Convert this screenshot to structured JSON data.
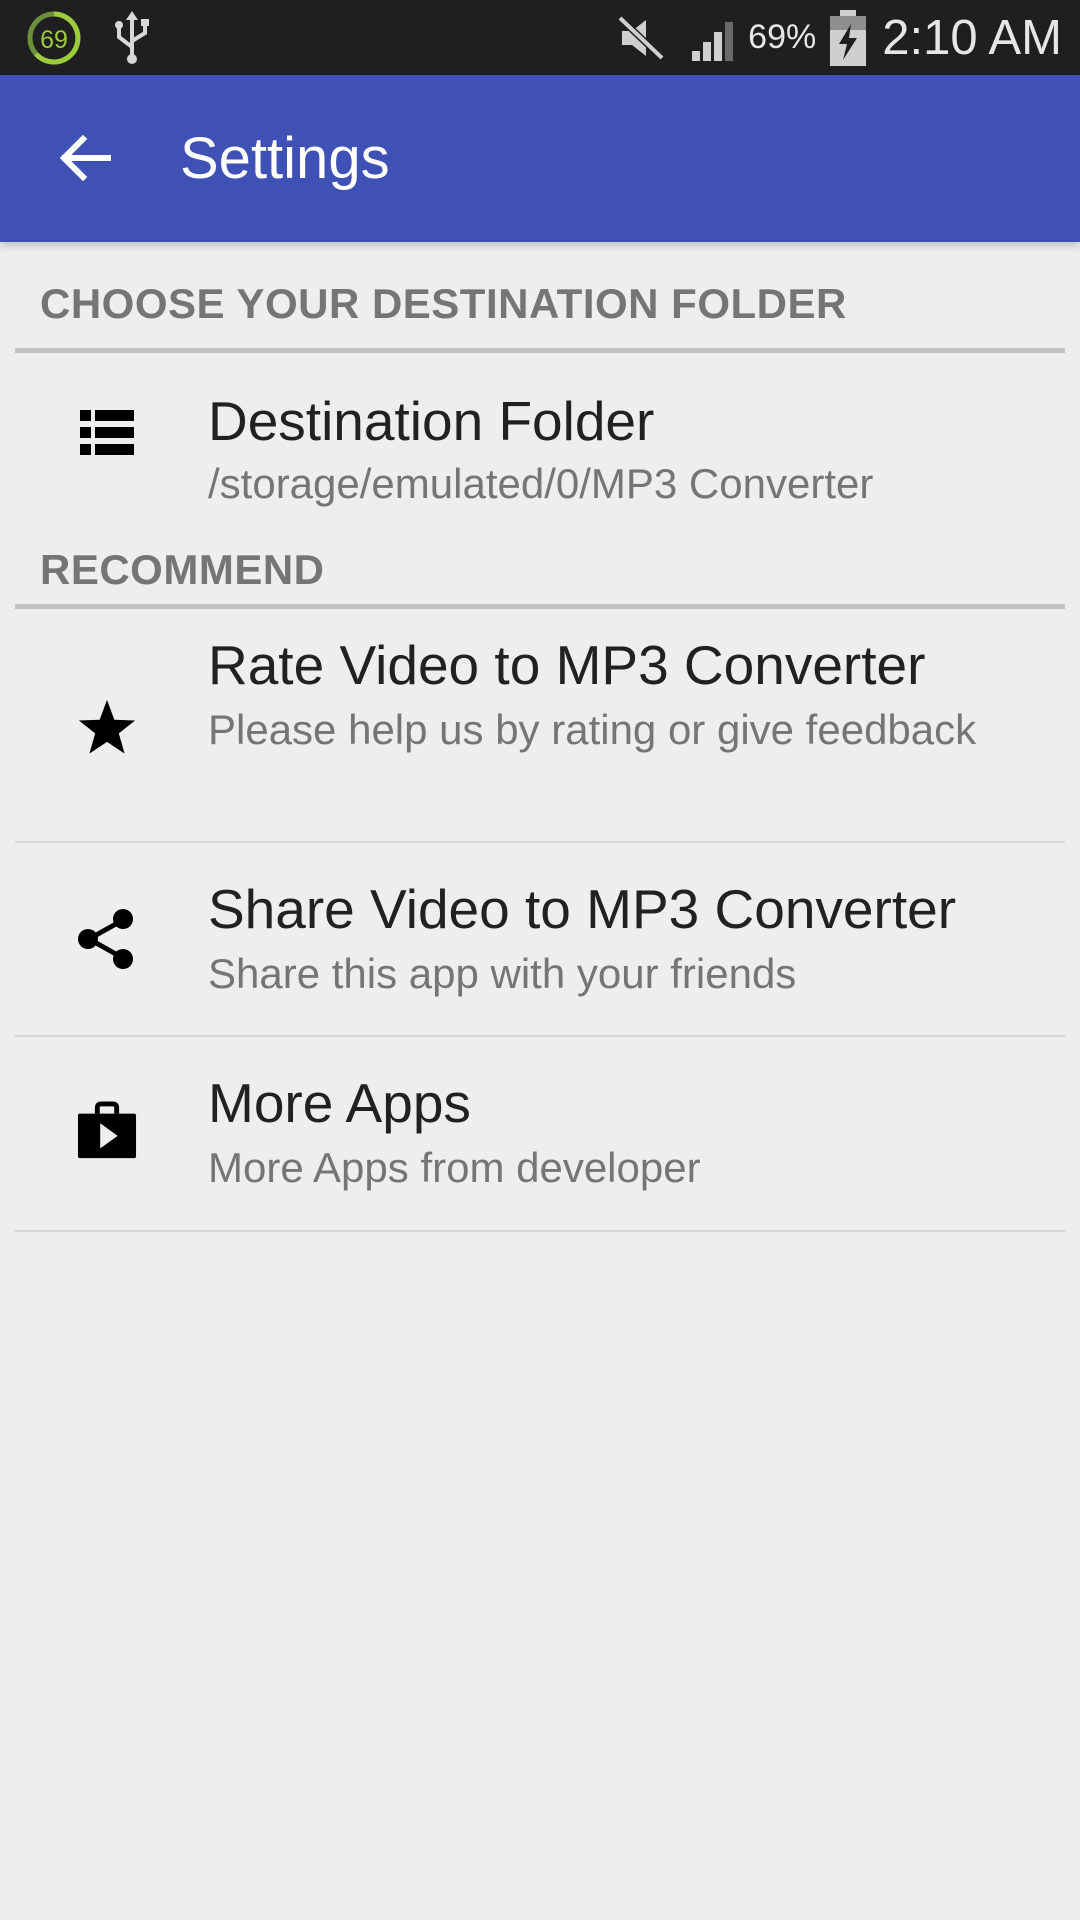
{
  "status_bar": {
    "notification_badge": "69",
    "battery_percent": "69%",
    "time": "2:10 AM",
    "icons": [
      "circle-69-icon",
      "usb-icon",
      "mute-icon",
      "signal-icon",
      "battery-charging-icon"
    ]
  },
  "toolbar": {
    "back_icon": "arrow-back-icon",
    "title": "Settings",
    "background_color": "#3f51b5"
  },
  "sections": [
    {
      "title": "CHOOSE YOUR DESTINATION FOLDER",
      "items": [
        {
          "icon": "list-icon",
          "title": "Destination Folder",
          "summary": "/storage/emulated/0/MP3 Converter"
        }
      ]
    },
    {
      "title": "RECOMMEND",
      "items": [
        {
          "icon": "star-icon",
          "title": "Rate Video to MP3 Converter",
          "summary": "Please help us by rating or give feedback"
        },
        {
          "icon": "share-icon",
          "title": "Share Video to MP3 Converter",
          "summary": "Share this app with your friends"
        },
        {
          "icon": "play-store-icon",
          "title": "More Apps",
          "summary": "More Apps from developer"
        }
      ]
    }
  ]
}
